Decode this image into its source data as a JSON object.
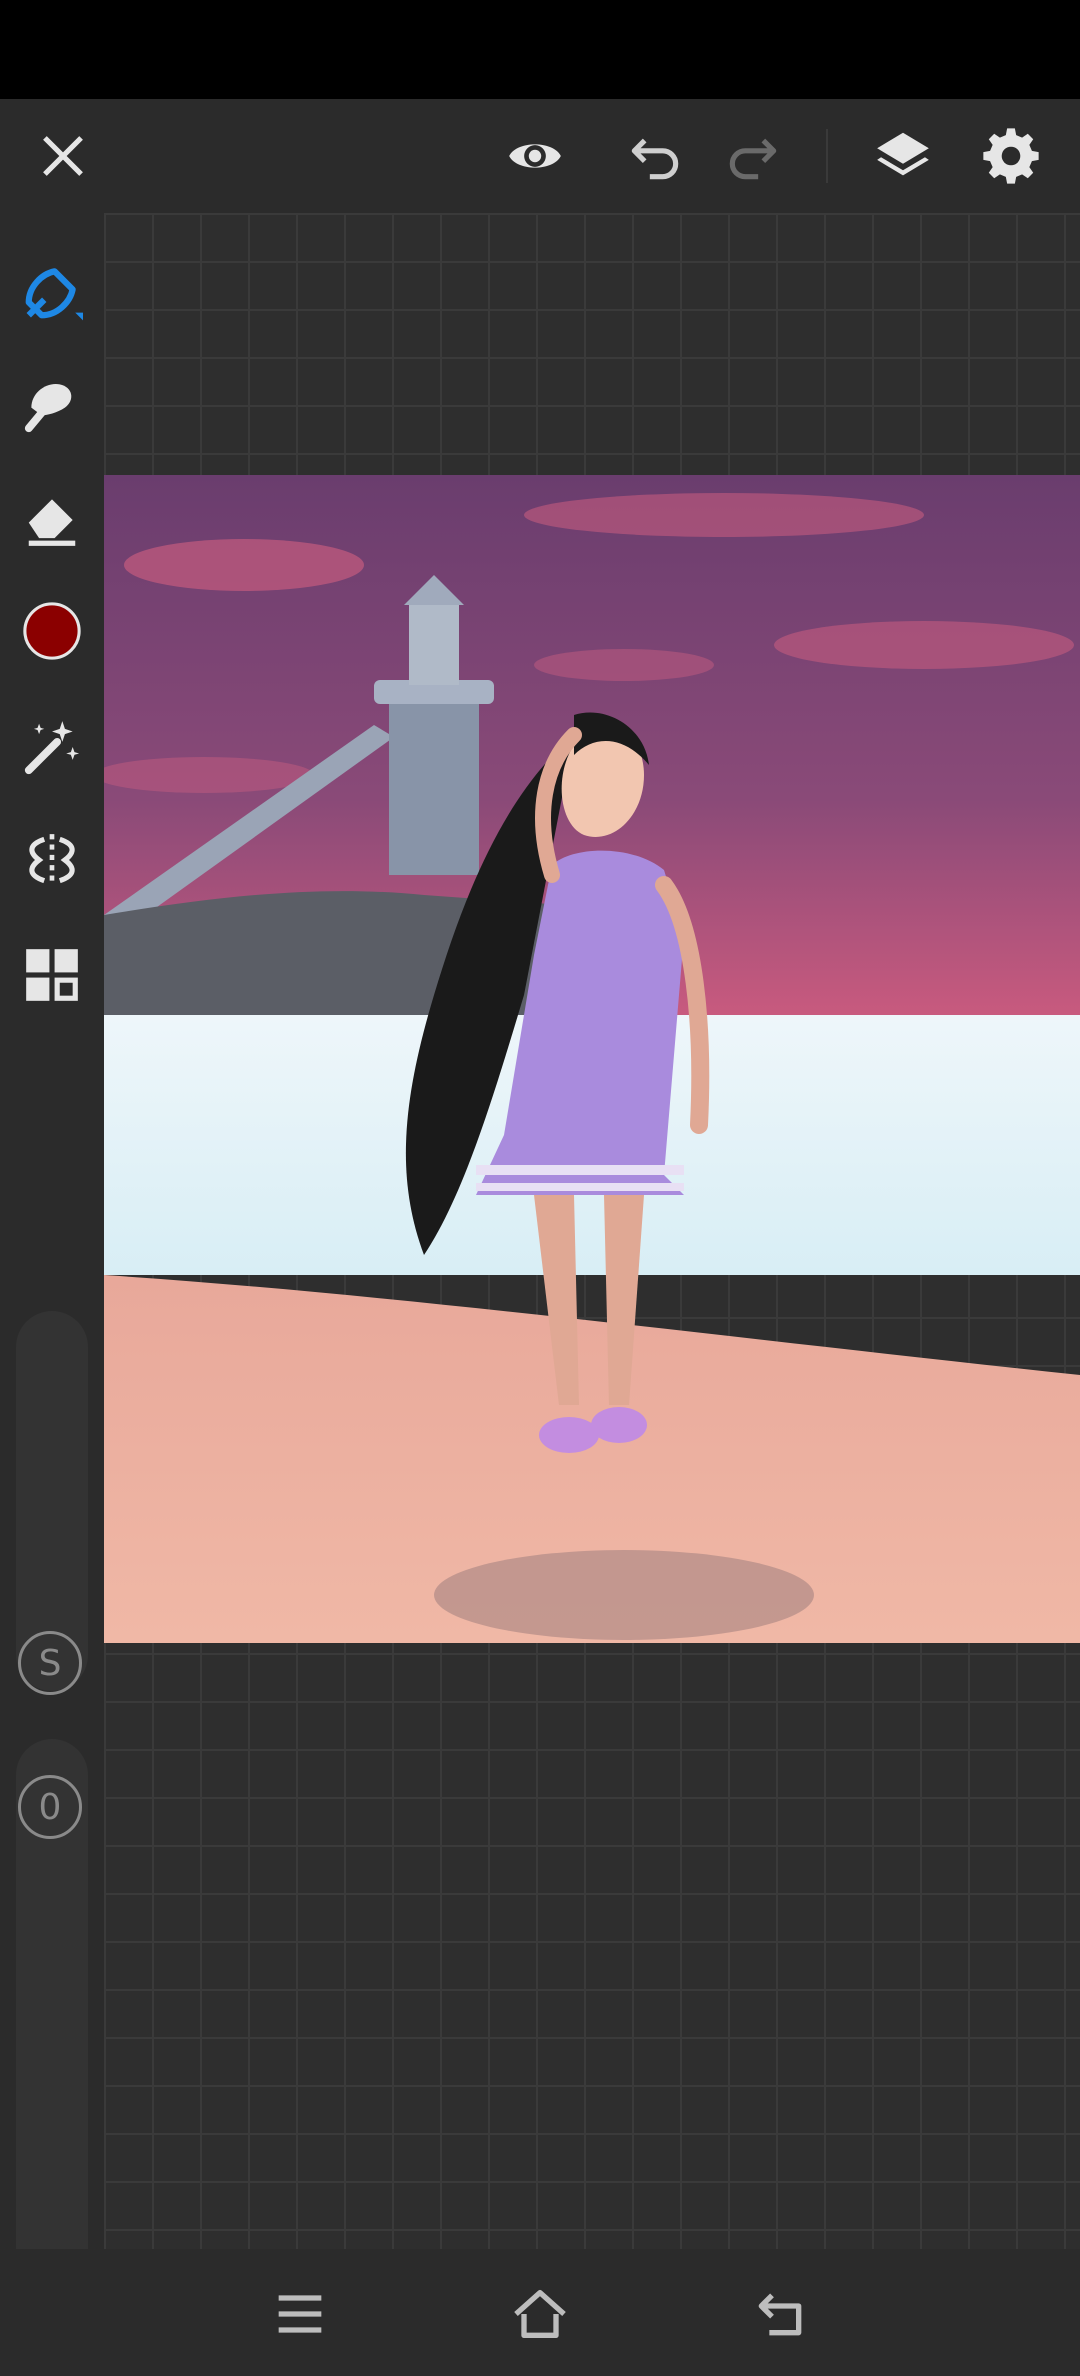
{
  "app": {
    "name": "drawing-app"
  },
  "toolbar": {
    "close_icon": "close-icon",
    "preview_icon": "eye-icon",
    "undo_icon": "undo-icon",
    "redo_icon": "redo-icon",
    "layers_icon": "layers-icon",
    "settings_icon": "gear-icon"
  },
  "tools": [
    {
      "name": "pen",
      "icon": "pen-icon",
      "active": true
    },
    {
      "name": "smudge",
      "icon": "smudge-icon"
    },
    {
      "name": "eraser",
      "icon": "eraser-icon"
    },
    {
      "name": "color",
      "icon": "color-swatch",
      "color": "#8b0000"
    },
    {
      "name": "magic",
      "icon": "magic-wand-icon"
    },
    {
      "name": "symmetry",
      "icon": "symmetry-icon"
    },
    {
      "name": "grid",
      "icon": "grid-icon"
    }
  ],
  "sliders": {
    "size_label": "S",
    "opacity_label": "0"
  },
  "colors": {
    "accent": "#1e88e5",
    "brush": "#8b0000",
    "background": "#2b2b2b"
  },
  "navigation": {
    "menu_icon": "menu-icon",
    "home_icon": "home-icon",
    "back_icon": "back-icon"
  }
}
